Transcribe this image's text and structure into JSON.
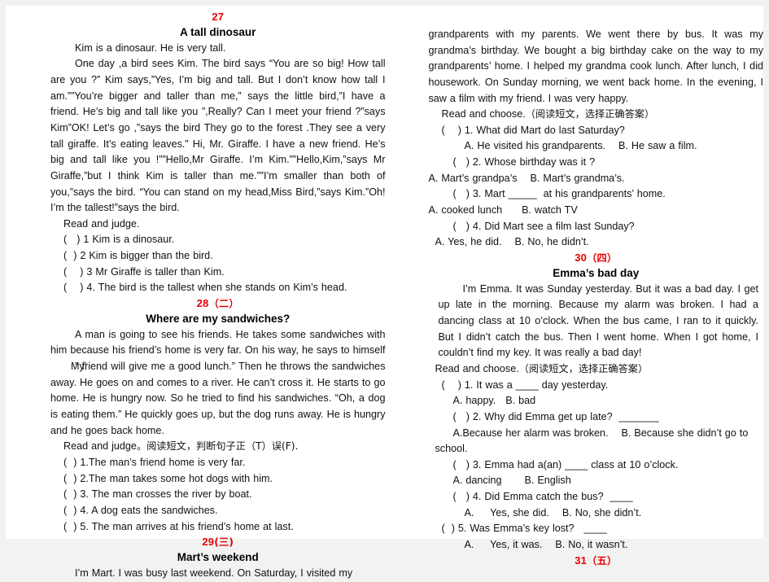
{
  "document": {
    "type": "english-reading-comprehension-worksheet",
    "page_bg": "#ffffff",
    "accent_color": "#e60000"
  },
  "left_column": {
    "section27": {
      "number": "27",
      "title": "A tall dinosaur",
      "para1": "Kim is a dinosaur. He is very tall.",
      "para2_a": "One day ,a bird sees Kim. The bird says “You are so big! How tall are you ?” Kim says,”Yes, I’m big and tall. But I don’t know how tall I am.””You’re bigger and taller than me,” says the little bird,”I have a friend. He’s big and tall like you ”,Really? Can I meet your friend ?”says Kim”OK! Let’s go ,”says the bird They go to the forest .They see a very tall giraffe. It’s eating leaves.” Hi, Mr. Giraffe. I have a new friend. He’s big and tall like you !””Hello,Mr Giraffe. I’m Kim.””Hello,Kim,”says Mr Giraffe,”but I think Kim is taller than me.””I’m smaller than both of you,”says the bird. “You can stand on my head,Miss Bird,”says Kim.”Oh! I’m the tallest!”says the bird.",
      "instruction": "Read and judge.",
      "questions": [
        "(   ) 1 Kim is a dinosaur.",
        "(  ) 2 Kim is bigger than the bird.",
        "(    ) 3 Mr Giraffe is taller than Kim.",
        "(    ) 4. The bird is the tallest when she stands on Kim’s head."
      ]
    },
    "section28": {
      "number": "28",
      "number_cn": "（二）",
      "title": "Where are my sandwiches?",
      "para1_pre": "A man is going to see his friends. He takes some sandwiches with him because his friend’s home is very far. On his way, he says to himself",
      "para1_overlap_a": "”",
      "para1_overlap_b": "My’",
      "para1_post": " friend will give me a good lunch.” Then he throws the sandwiches away. He goes on and comes to a river. He can’t cross it. He starts to go home. He is hungry now. So he tried to find his  sandwiches. “Oh, a dog is eating them.” He quickly goes up, but the dog runs away. He is hungry and he goes back home.",
      "instruction_en": "Read and judge",
      "instruction_cn": "。阅读短文，判断句子正（T）误(F).",
      "questions": [
        "(  ) 1.The man’s friend home is very far.",
        "(  ) 2.The man takes some hot dogs with him.",
        "(  ) 3. The man crosses the river by boat.",
        "(  ) 4. A dog eats the sandwiches.",
        "(  ) 5. The man arrives at his friend’s home at last."
      ]
    },
    "section29": {
      "number": "29",
      "number_cn": "(三)",
      "title": "Mart’s weekend",
      "para1_start": "I’m Mart. I was busy last weekend. On Saturday, I visited my"
    }
  },
  "right_column": {
    "section29_cont": {
      "para1_cont": "grandparents with my parents. We went there by bus. It was my grandma’s birthday. We bought a big birthday cake on the way to my grandparents’ home. I helped my grandma cook lunch. After lunch, I did housework. On Sunday morning, we went back home. In the evening, I saw a film with my friend. I was very happy.",
      "instruction_en": "Read and choose.",
      "instruction_cn": "（阅读短文，选择正确答案）",
      "q1": "(    ) 1. What did Mart do last Saturday?",
      "q1_options": "A. He visited his grandparents.    B. He saw a film.",
      "q2": "(   ) 2. Whose birthday was it ?",
      "q2_options": "A. Mart’s grandpa’s    B. Mart’s grandma’s.",
      "q3": "(   ) 3. Mart _____  at his grandparents’ home.",
      "q3_options": "A. cooked lunch      B. watch TV",
      "q4": "(   ) 4. Did Mart see a film last Sunday?",
      "q4_options": "A. Yes, he did.    B. No, he didn’t."
    },
    "section30": {
      "number": "30",
      "number_cn": "（四）",
      "title": "Emma’s bad day",
      "para1": "I’m Emma. It was Sunday yesterday. But it was a bad day. I get up late in the morning. Because my alarm was broken. I had a dancing class at 10 o’clock. When the bus came, I ran to it quickly. But I didn’t catch the bus. Then I went home. When I got home, I couldn’t find my key. It was really a bad day!",
      "instruction_en": "Read and choose.",
      "instruction_cn": "（阅读短文，选择正确答案）",
      "q1": "(    ) 1. It was a ____ day yesterday.",
      "q1_options": "A. happy.   B. bad",
      "q2": "(   ) 2. Why did Emma get up late?  _______",
      "q2_options_a": "A.Because her alarm was broken.    B. Because she didn’t go to",
      "q2_options_b": "school.",
      "q3": "(   ) 3. Emma had a(an) ____ class at 10 o’clock.",
      "q3_options": "A. dancing       B. English",
      "q4": "(   ) 4. Did Emma catch the bus?  ____",
      "q4_options": "A.     Yes, she did.    B. No, she didn’t.",
      "q5": "(  ) 5. Was Emma’s key lost?   ____",
      "q5_options": "A.     Yes, it was.    B. No, it wasn’t."
    },
    "section31": {
      "number": "31",
      "number_cn": "（五）"
    }
  }
}
